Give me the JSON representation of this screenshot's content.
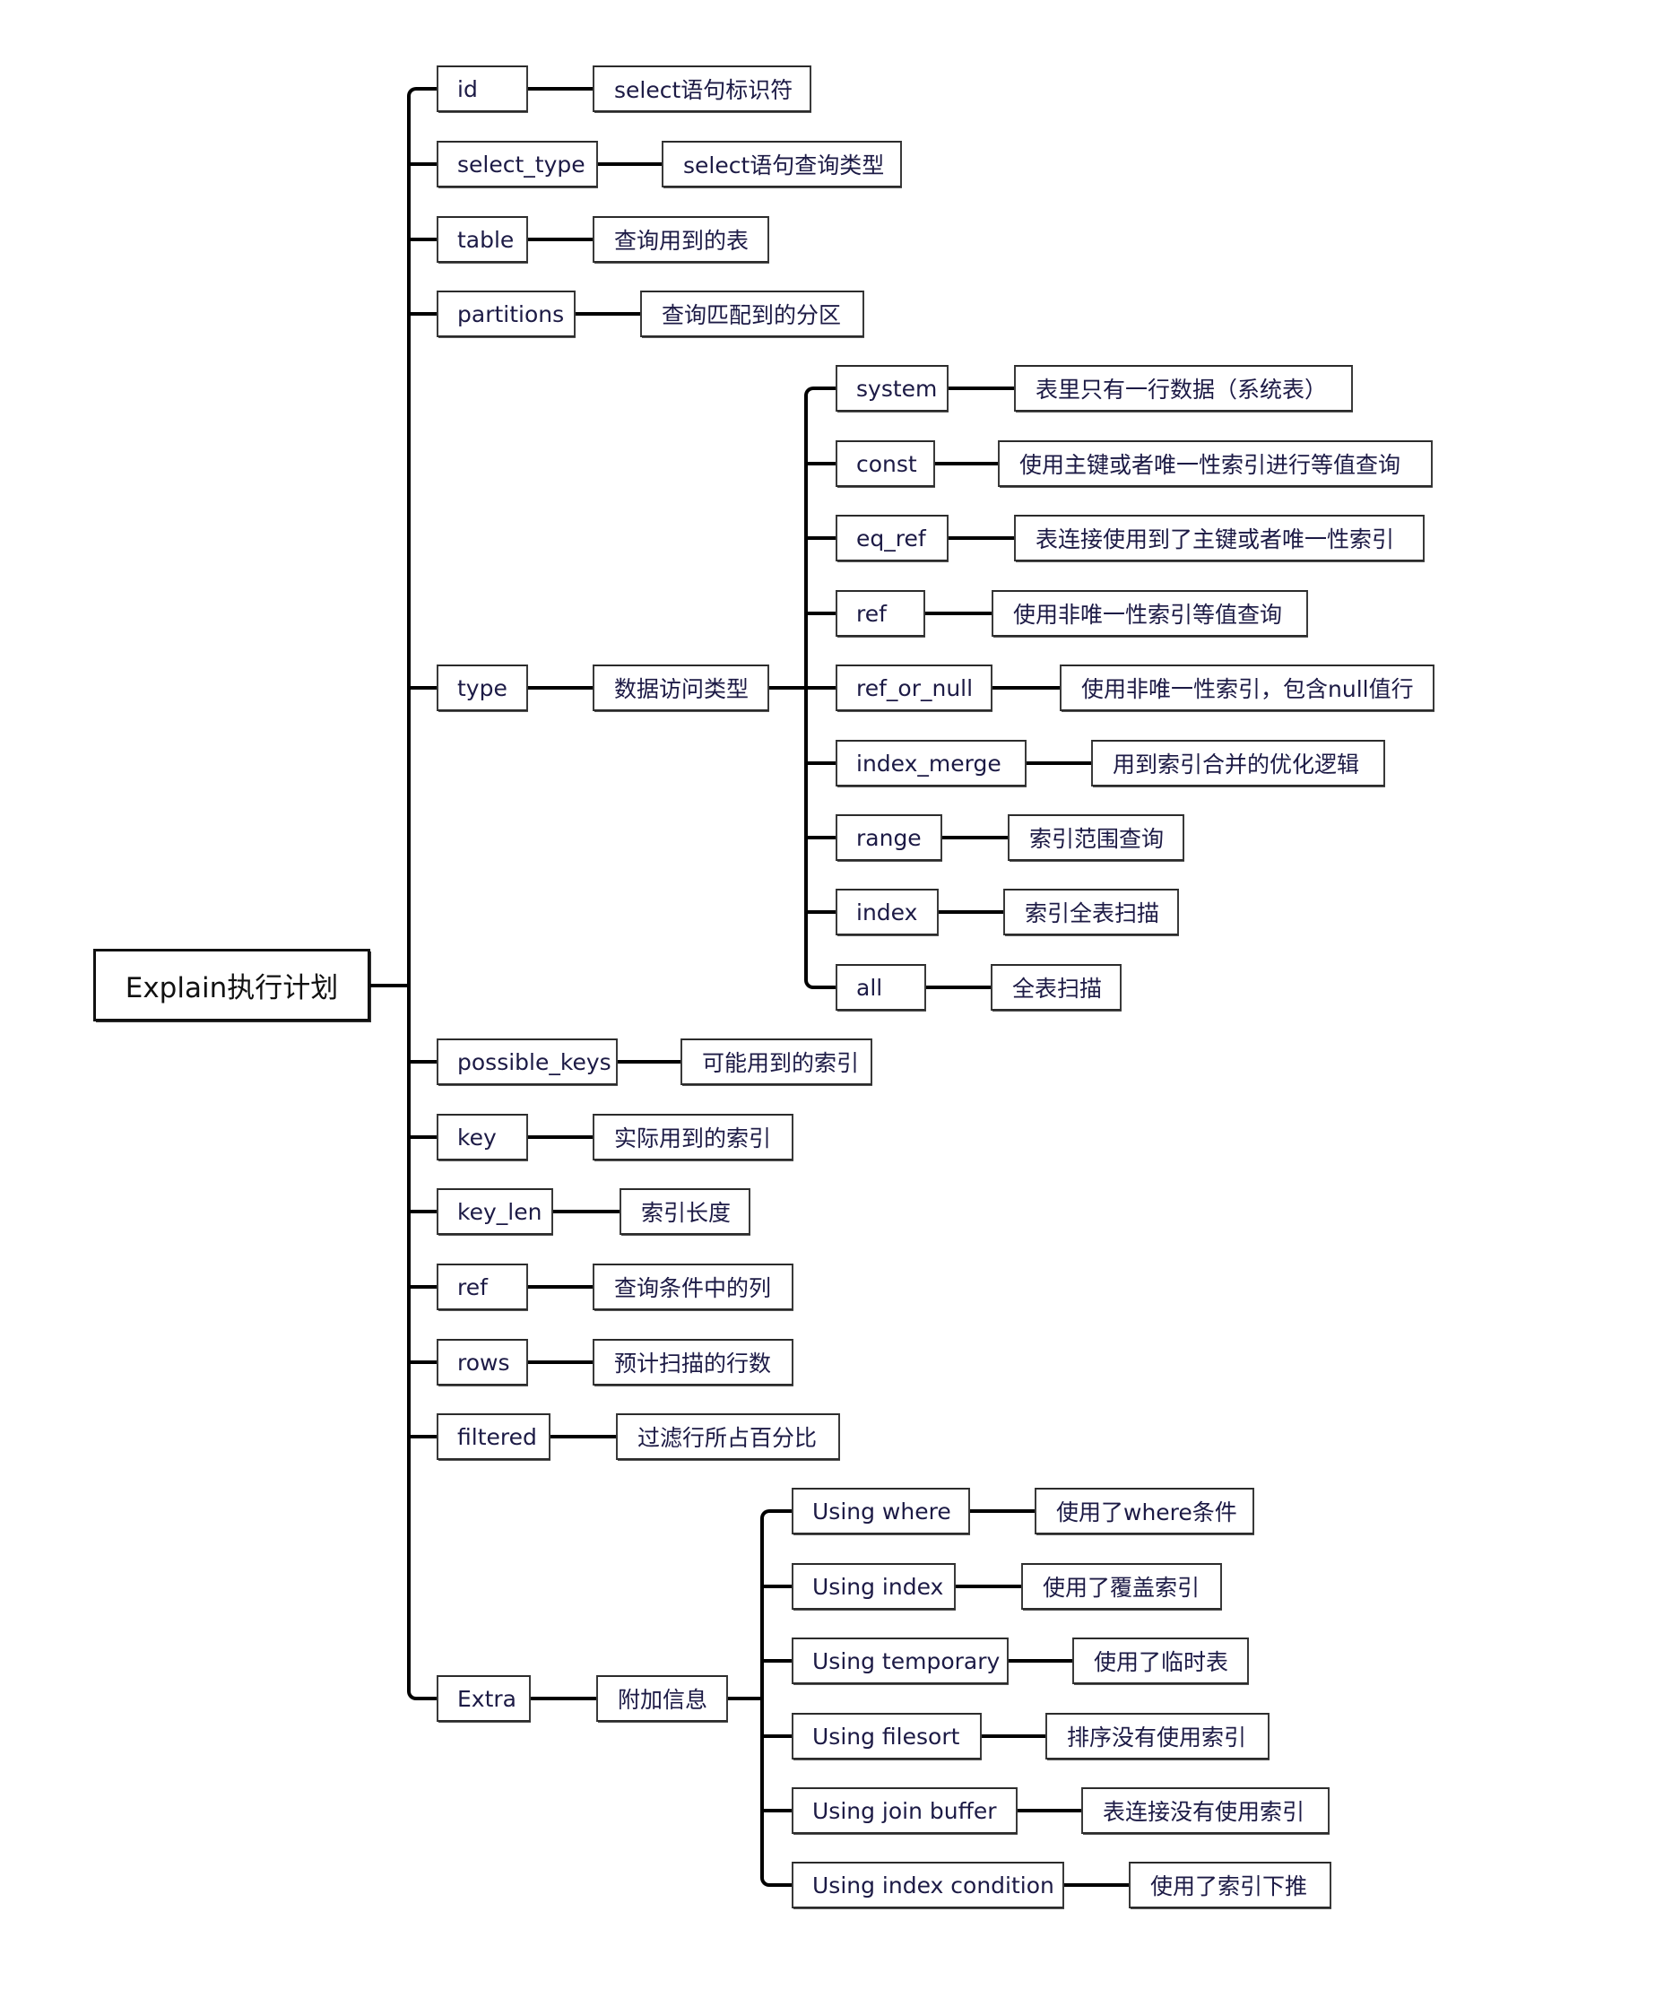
{
  "root": {
    "label": "Explain执行计划"
  },
  "fields": [
    {
      "name": "id",
      "desc": "select语句标识符"
    },
    {
      "name": "select_type",
      "desc": "select语句查询类型"
    },
    {
      "name": "table",
      "desc": "查询用到的表"
    },
    {
      "name": "partitions",
      "desc": "查询匹配到的分区"
    },
    {
      "name": "type",
      "desc": "数据访问类型",
      "children": [
        {
          "name": "system",
          "desc": "表里只有一行数据（系统表）"
        },
        {
          "name": "const",
          "desc": "使用主键或者唯一性索引进行等值查询"
        },
        {
          "name": "eq_ref",
          "desc": "表连接使用到了主键或者唯一性索引"
        },
        {
          "name": "ref",
          "desc": "使用非唯一性索引等值查询"
        },
        {
          "name": "ref_or_null",
          "desc": "使用非唯一性索引，包含null值行"
        },
        {
          "name": "index_merge",
          "desc": "用到索引合并的优化逻辑"
        },
        {
          "name": "range",
          "desc": "索引范围查询"
        },
        {
          "name": "index",
          "desc": "索引全表扫描"
        },
        {
          "name": "all",
          "desc": "全表扫描"
        }
      ]
    },
    {
      "name": "possible_keys",
      "desc": "可能用到的索引"
    },
    {
      "name": "key",
      "desc": "实际用到的索引"
    },
    {
      "name": "key_len",
      "desc": "索引长度"
    },
    {
      "name": "ref",
      "desc": "查询条件中的列"
    },
    {
      "name": "rows",
      "desc": "预计扫描的行数"
    },
    {
      "name": "filtered",
      "desc": "过滤行所占百分比"
    },
    {
      "name": "Extra",
      "desc": "附加信息",
      "children": [
        {
          "name": "Using where",
          "desc": "使用了where条件"
        },
        {
          "name": "Using index",
          "desc": "使用了覆盖索引"
        },
        {
          "name": "Using temporary",
          "desc": "使用了临时表"
        },
        {
          "name": "Using filesort",
          "desc": "排序没有使用索引"
        },
        {
          "name": "Using join buffer",
          "desc": "表连接没有使用索引"
        },
        {
          "name": "Using index condition",
          "desc": "使用了索引下推"
        }
      ]
    }
  ],
  "colors": {
    "line": "#000000",
    "text": "#1c1a45",
    "root_text": "#111111",
    "border": "#2b2b2b"
  }
}
